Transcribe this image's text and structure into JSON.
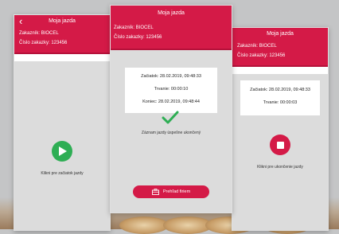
{
  "screen_left": {
    "title": "Moja jazda",
    "customer": "Zakazník: BIOCEL",
    "order": "Číslo zakazky: 123456",
    "start_hint": "Klikni pre začiatok jazdy"
  },
  "screen_center": {
    "title": "Moja jazda",
    "customer": "Zakazník: BIOCEL",
    "order": "Číslo zakazky: 123456",
    "start_line": "Začiatok: 28.02.2019, 09:48:33",
    "duration_line": "Trvanie: 00:00:10",
    "end_line": "Koniec: 28.02.2019, 09:48:44",
    "success_message": "Záznam jazdy úspešne ukončený",
    "overview_button": "Prehľad firiem"
  },
  "screen_right": {
    "title": "Moja jazda",
    "customer": "Zakazník: BIOCEL",
    "order": "Číslo zakazky: 123456",
    "start_line": "Začiatok: 28.02.2019, 09:48:33",
    "duration_line": "Trvanie: 00:00:03",
    "end_hint": "Klikni pre ukončenie jazdy"
  },
  "colors": {
    "brand": "#d41a47",
    "start": "#2eae54"
  },
  "icons": [
    "back-arrow-icon",
    "play-icon",
    "checkmark-icon",
    "stop-icon",
    "company-overview-icon"
  ]
}
